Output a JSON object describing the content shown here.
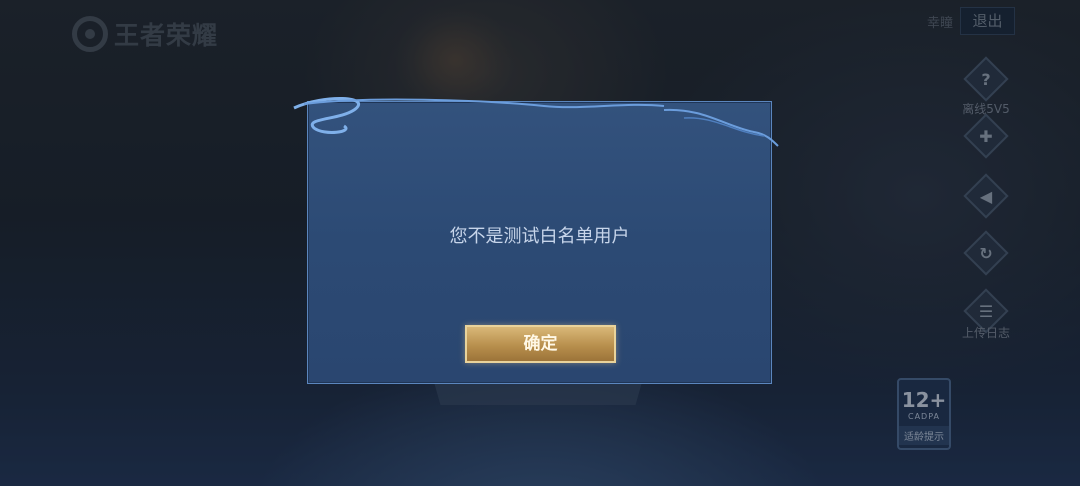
{
  "header": {
    "logo_text": "王者荣耀",
    "account_name": "幸瞳",
    "logout_label": "退出"
  },
  "side_menu": {
    "items": [
      {
        "icon": "help-icon",
        "glyph": "?",
        "label": "离线5V5"
      },
      {
        "icon": "gamepad-icon",
        "glyph": "✚",
        "label": ""
      },
      {
        "icon": "speaker-icon",
        "glyph": "◀",
        "label": ""
      },
      {
        "icon": "refresh-icon",
        "glyph": "↻",
        "label": ""
      },
      {
        "icon": "log-icon",
        "glyph": "☰",
        "label": "上传日志"
      }
    ]
  },
  "age_rating": {
    "age": "12+",
    "org": "CADPA",
    "hint": "适龄提示"
  },
  "dialog": {
    "message": "您不是测试白名单用户",
    "confirm_label": "确定"
  },
  "colors": {
    "dialog_bg": "#2c4a74",
    "dialog_border": "#5b86be",
    "confirm_gold": "#c9a35e"
  }
}
